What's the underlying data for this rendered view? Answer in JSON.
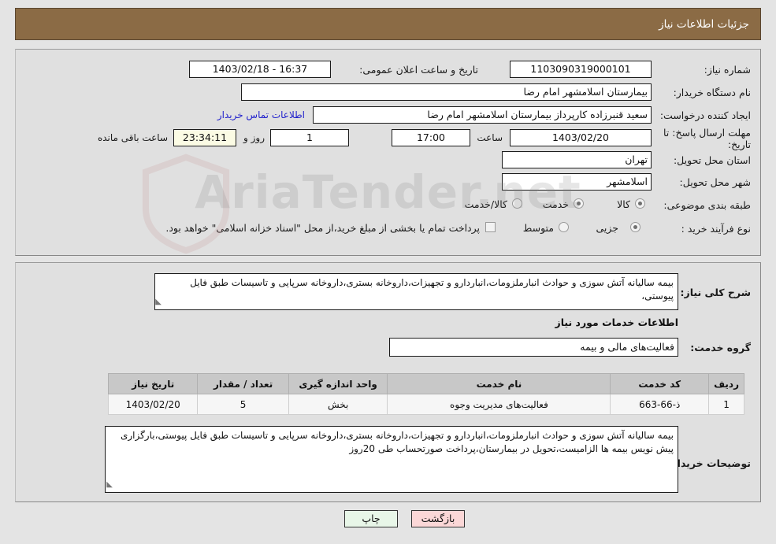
{
  "header": {
    "title": "جزئیات اطلاعات نیاز"
  },
  "watermark": {
    "text": "AriaTender.net"
  },
  "form": {
    "need_number": {
      "label": "شماره نیاز:",
      "value": "1103090319000101"
    },
    "announce_datetime": {
      "label": "تاریخ و ساعت اعلان عمومی:",
      "value": "16:37 - 1403/02/18"
    },
    "buyer_org": {
      "label": "نام دستگاه خریدار:",
      "value": "بیمارستان اسلامشهر   امام رضا"
    },
    "request_creator": {
      "label": "ایجاد کننده درخواست:",
      "value": "سعید قنبرزاده کارپرداز بیمارستان اسلامشهر   امام رضا"
    },
    "contact_link": {
      "label": "اطلاعات تماس خریدار"
    },
    "deadline": {
      "label": "مهلت ارسال پاسخ: تا تاریخ:",
      "date": "1403/02/20",
      "time_label": "ساعت",
      "time": "17:00",
      "days": "1",
      "days_label": "روز و",
      "remaining": "23:34:11",
      "remaining_label": "ساعت باقی مانده"
    },
    "province": {
      "label": "استان محل تحویل:",
      "value": "تهران"
    },
    "city": {
      "label": "شهر محل تحویل:",
      "value": "اسلامشهر"
    },
    "category": {
      "label": "طبقه بندی موضوعی:",
      "options": [
        {
          "label": "کالا",
          "selected": false
        },
        {
          "label": "خدمت",
          "selected": true
        },
        {
          "label": "کالا/خدمت",
          "selected": false
        }
      ]
    },
    "process_type": {
      "label": "نوع فرآیند خرید :",
      "options": [
        {
          "label": "جزیی",
          "selected": true
        },
        {
          "label": "متوسط",
          "selected": false
        }
      ]
    },
    "treasury_note": {
      "checked": false,
      "label": "پرداخت تمام یا بخشی از مبلغ خرید،از محل \"اسناد خزانه اسلامی\" خواهد بود."
    }
  },
  "details": {
    "need_description": {
      "label": "شرح کلی نیاز:",
      "value": "بیمه سالیانه آتش سوزی و حوادث انبارملزومات،انباردارو و تجهیزات،داروخانه بستری،داروخانه سرپایی و تاسیسات طبق فایل پیوستی،"
    },
    "services_section_title": "اطلاعات خدمات مورد نیاز",
    "service_group": {
      "label": "گروه خدمت:",
      "value": "فعالیت‌های مالی و بیمه"
    },
    "table": {
      "columns": [
        "ردیف",
        "کد خدمت",
        "نام خدمت",
        "واحد اندازه گیری",
        "تعداد / مقدار",
        "تاریخ نیاز"
      ],
      "rows": [
        {
          "row_no": "1",
          "service_code": "ذ-66-663",
          "service_name": "فعالیت‌های مدیریت وجوه",
          "unit": "بخش",
          "quantity": "5",
          "need_date": "1403/02/20"
        }
      ]
    },
    "buyer_notes": {
      "label": "توضیحات خریدار:",
      "value": "بیمه سالیانه آتش سوزی و حوادث انبارملزومات،انباردارو و تجهیزات،داروخانه بستری،داروخانه سرپایی و تاسیسات طبق فایل پیوستی،بارگزاری پیش نویس بیمه ها الزامیست،تحویل در بیمارستان،پرداخت صورتحساب طی 20روز"
    }
  },
  "footer": {
    "print_button": "چاپ",
    "back_button": "بازگشت"
  }
}
